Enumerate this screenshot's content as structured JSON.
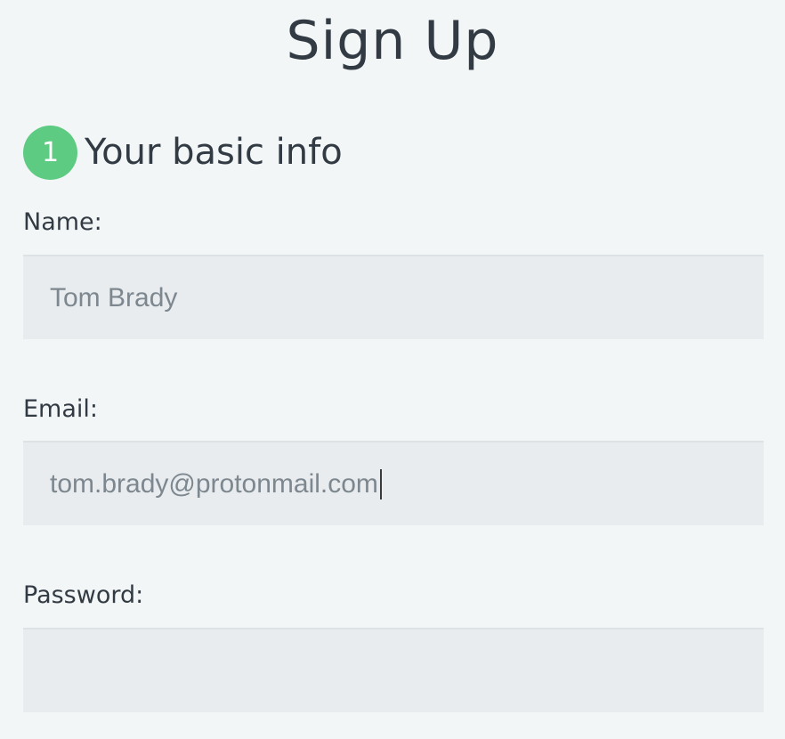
{
  "page": {
    "title": "Sign Up"
  },
  "section": {
    "step_number": "1",
    "title": "Your basic info"
  },
  "fields": {
    "name": {
      "label": "Name:",
      "value": "Tom Brady"
    },
    "email": {
      "label": "Email:",
      "value": "tom.brady@protonmail.com"
    },
    "password": {
      "label": "Password:",
      "value": ""
    }
  },
  "colors": {
    "background": "#f3f6f7",
    "badge": "#5dcb82",
    "input_background": "#e8ecee",
    "text": "#323b43",
    "input_text": "#7d878f"
  }
}
